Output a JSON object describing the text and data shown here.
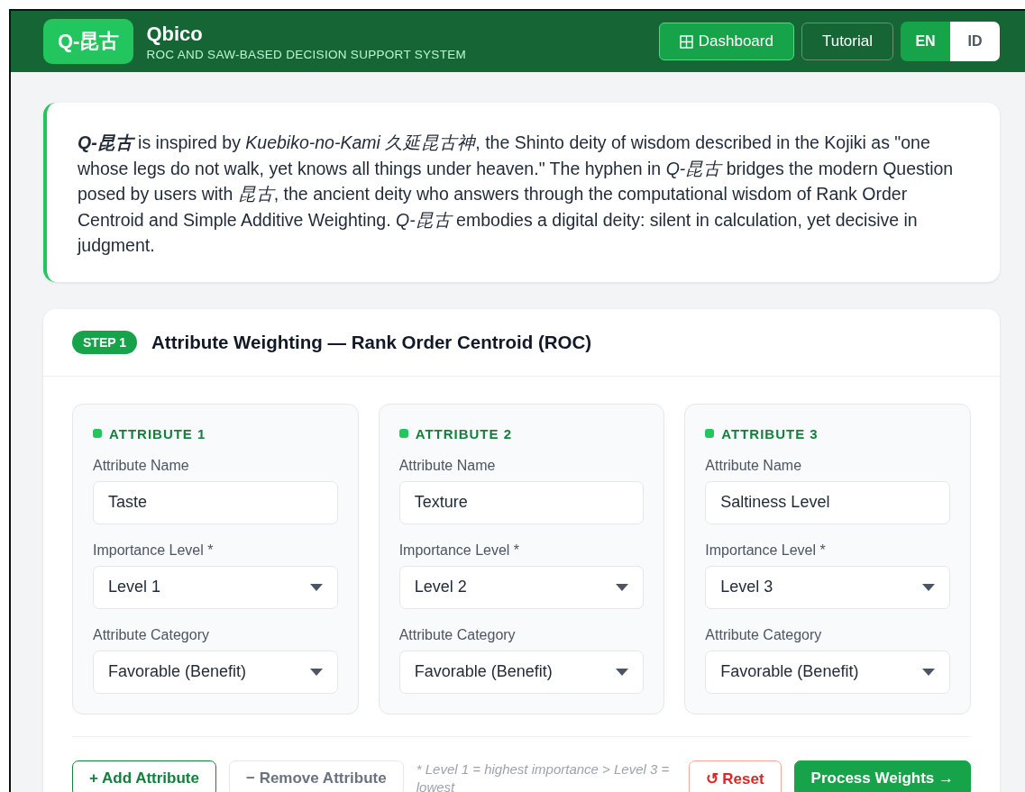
{
  "header": {
    "logo": "Q-昆古",
    "title": "Qbico",
    "subtitle": "ROC AND SAW-BASED DECISION SUPPORT SYSTEM",
    "nav": [
      {
        "label": "Dashboard",
        "kind": "primary"
      },
      {
        "label": "Tutorial",
        "kind": "outline"
      }
    ],
    "languages": [
      {
        "label": "EN",
        "selected": true
      },
      {
        "label": "ID",
        "selected": false
      }
    ]
  },
  "intro": "**Q-昆古** is inspired by *Kuebiko-no-Kami 久延昆古神*, the Shinto deity of wisdom described in the Kojiki as \"one whose legs do not walk, yet knows all things under heaven.\" The hyphen in *Q-昆古* bridges the modern Question posed by users with *昆古*, the ancient deity who answers through the computational wisdom of Rank Order Centroid and Simple Additive Weighting. *Q-昆古* embodies a digital deity: silent in calculation, yet decisive in judgment.",
  "step": {
    "badge": "STEP 1",
    "title": "Attribute Weighting — Rank Order Centroid (ROC)",
    "attributes": [
      {
        "heading": "ATTRIBUTE 1",
        "name_label": "Attribute Name",
        "name": "Taste",
        "level_label": "Importance Level *",
        "level": "Level 1",
        "category_label": "Attribute Category",
        "category": "Favorable (Benefit)"
      },
      {
        "heading": "ATTRIBUTE 2",
        "name_label": "Attribute Name",
        "name": "Texture",
        "level_label": "Importance Level *",
        "level": "Level 2",
        "category_label": "Attribute Category",
        "category": "Favorable (Benefit)"
      },
      {
        "heading": "ATTRIBUTE 3",
        "name_label": "Attribute Name",
        "name": "Saltiness Level",
        "level_label": "Importance Level *",
        "level": "Level 3",
        "category_label": "Attribute Category",
        "category": "Favorable (Benefit)"
      }
    ],
    "actions": [
      {
        "label": "+ Add Attribute",
        "kind": "add"
      },
      {
        "label": "− Remove Attribute",
        "kind": "remove"
      }
    ],
    "note": "* Level 1 = highest importance > Level 3 = lowest",
    "submit_actions": [
      {
        "label": "↺ Reset",
        "kind": "reset"
      },
      {
        "label": "Process Weights →",
        "kind": "process"
      }
    ]
  }
}
